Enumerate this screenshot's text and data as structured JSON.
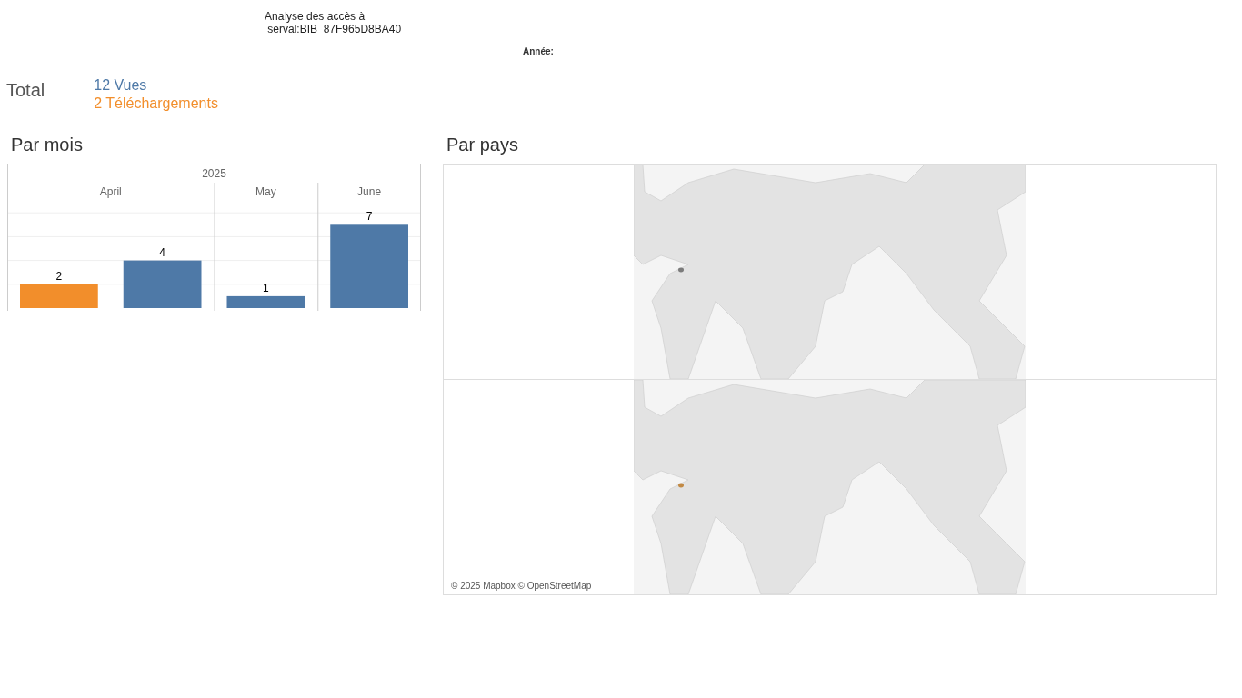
{
  "title": [
    "Analyse des accès à",
    " serval:BIB_87F965D8BA40"
  ],
  "filter": {
    "label": "Année:"
  },
  "total": {
    "label": "Total",
    "measures": [
      {
        "text": "12 Vues",
        "color": "#4e79a7"
      },
      {
        "text": "2 Téléchargements",
        "color": "#f28e2b"
      }
    ]
  },
  "by_month": {
    "title": "Par mois",
    "chart_data": {
      "type": "bar",
      "xlabel": "2025",
      "categories": [
        "April",
        "May",
        "June"
      ],
      "data_labels": true,
      "series": [
        {
          "color": "#f28e2b",
          "values": [
            2,
            null,
            null
          ]
        },
        {
          "color": "#4e79a7",
          "values": [
            4,
            1,
            7
          ]
        }
      ]
    }
  },
  "by_country": {
    "title": "Par pays",
    "maps": [
      {
        "color": "#7b7b7b"
      },
      {
        "color": "#c28a45"
      }
    ],
    "attribution": "© 2025 Mapbox © OpenStreetMap"
  }
}
